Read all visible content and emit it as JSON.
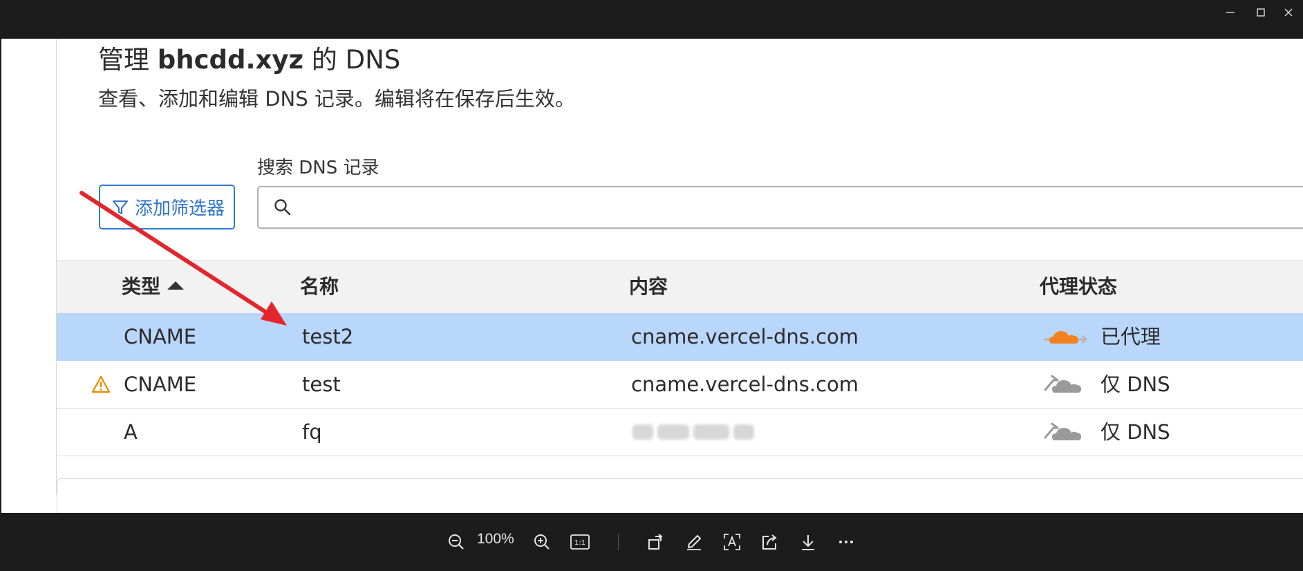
{
  "window_controls": {
    "minimize": "minimize",
    "maximize": "maximize",
    "close": "close"
  },
  "page": {
    "title_prefix": "管理 ",
    "title_domain": "bhcdd.xyz",
    "title_suffix": " 的 DNS",
    "description": "查看、添加和编辑 DNS 记录。编辑将在保存后生效。"
  },
  "filter_button": {
    "label": "添加筛选器",
    "icon": "filter-icon"
  },
  "search": {
    "label": "搜索 DNS 记录",
    "placeholder": "",
    "value": "",
    "icon": "search-icon"
  },
  "table": {
    "headers": {
      "type": "类型",
      "name": "名称",
      "content": "内容",
      "proxy": "代理状态"
    },
    "rows": [
      {
        "type": "CNAME",
        "name": "test2",
        "content": "cname.vercel-dns.com",
        "proxy": "已代理",
        "proxy_icon": "proxied-cloud-icon",
        "selected": true,
        "warning": false
      },
      {
        "type": "CNAME",
        "name": "test",
        "content": "cname.vercel-dns.com",
        "proxy": "仅 DNS",
        "proxy_icon": "dns-only-cloud-icon",
        "selected": false,
        "warning": true
      },
      {
        "type": "A",
        "name": "fq",
        "content": "",
        "proxy": "仅 DNS",
        "proxy_icon": "dns-only-cloud-icon",
        "selected": false,
        "warning": false
      }
    ]
  },
  "viewer_toolbar": {
    "zoom": "100%",
    "buttons": [
      "zoom-out-icon",
      "zoom-in-icon",
      "actual-size-icon",
      "rotate-icon",
      "edit-icon",
      "text-select-icon",
      "share-icon",
      "download-icon",
      "more-icon"
    ]
  },
  "colors": {
    "accent_blue": "#2f7bd0",
    "selected_row": "#b9d6fb",
    "proxy_orange": "#f48120",
    "warning_orange": "#e58a00",
    "annotation_red": "#e3262b"
  }
}
